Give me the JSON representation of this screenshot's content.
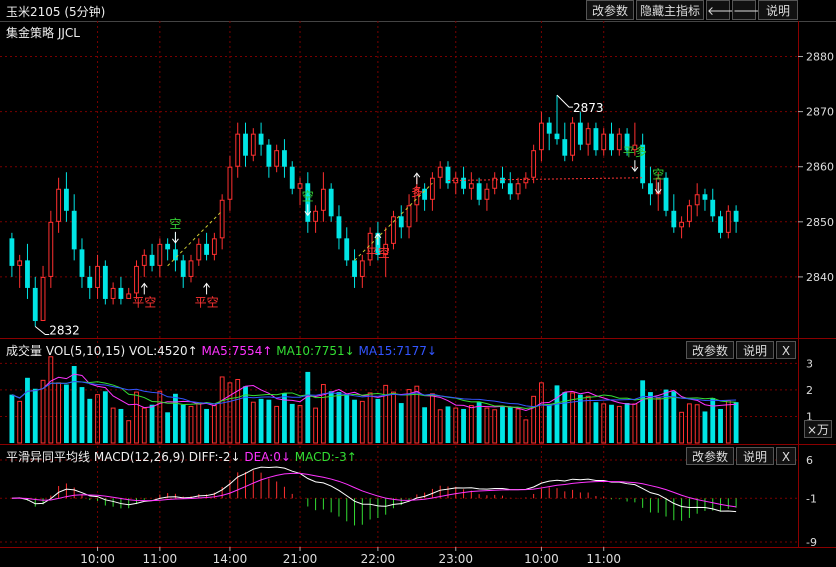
{
  "header": {
    "title": "玉米2105 (5分钟)",
    "modify_params": "改参数",
    "hide_indicator": "隐藏主指标",
    "prev_arrow": "🡐",
    "next_arrow": "🡒",
    "help": "说明"
  },
  "main_panel": {
    "indicator_label": "集金策略 JJCL",
    "price_axis": [
      "2880",
      "2870",
      "2860",
      "2850",
      "2840"
    ],
    "high_label": "2873",
    "low_label": "2832",
    "signals": [
      {
        "text": "空",
        "color": "#33cc33",
        "arrow": "down"
      },
      {
        "text": "平空",
        "color": "#ff3333",
        "arrow": "up"
      },
      {
        "text": "平空",
        "color": "#ff3333",
        "arrow": "up"
      },
      {
        "text": "空",
        "color": "#33cc33",
        "arrow": "down"
      },
      {
        "text": "平空",
        "color": "#ff3333",
        "arrow": "up"
      },
      {
        "text": "多",
        "color": "#ff3333",
        "arrow": "up"
      },
      {
        "text": "平多",
        "color": "#33cc33",
        "arrow": "down"
      },
      {
        "text": "空",
        "color": "#33cc33",
        "arrow": "down"
      }
    ]
  },
  "volume_panel": {
    "title": "成交量",
    "vol_text": "VOL(5,10,15)  VOL:4520↑",
    "ma5_text": "MA5:7554↑",
    "ma10_text": "MA10:7751↓",
    "ma15_text": "MA15:7177↓",
    "modify_params": "改参数",
    "help": "说明",
    "close": "X",
    "axis": [
      "3",
      "2",
      "1"
    ],
    "unit": "×万"
  },
  "macd_panel": {
    "title": "平滑异同平均线",
    "macd_text": "MACD(12,26,9)  DIFF:-2↓",
    "dea_text": "DEA:0↓",
    "macd_val_text": "MACD:-3↑",
    "modify_params": "改参数",
    "help": "说明",
    "close": "X",
    "axis": [
      "6",
      "-1",
      "-9"
    ]
  },
  "time_axis": [
    "10:00",
    "11:00",
    "14:00",
    "21:00",
    "22:00",
    "23:00",
    "10:00",
    "11:00"
  ],
  "colors": {
    "up": "#ff3030",
    "down": "#00e5e5",
    "ma5": "#ff33ff",
    "ma10": "#33dd33",
    "ma15": "#3355ff",
    "dif": "#ffffff",
    "dea": "#ff33ff",
    "grid": "#7a0000"
  },
  "chart_data": {
    "type": "candlestick",
    "yrange": [
      2830,
      2883
    ],
    "candles": [
      [
        2847,
        2848,
        2840,
        2842
      ],
      [
        2842,
        2844,
        2838,
        2843
      ],
      [
        2843,
        2846,
        2836,
        2838
      ],
      [
        2838,
        2840,
        2831,
        2832
      ],
      [
        2832,
        2842,
        2832,
        2840
      ],
      [
        2840,
        2852,
        2838,
        2850
      ],
      [
        2850,
        2858,
        2848,
        2856
      ],
      [
        2856,
        2859,
        2850,
        2852
      ],
      [
        2852,
        2855,
        2843,
        2845
      ],
      [
        2845,
        2847,
        2838,
        2840
      ],
      [
        2840,
        2842,
        2836,
        2838
      ],
      [
        2838,
        2844,
        2836,
        2842
      ],
      [
        2842,
        2843,
        2835,
        2836
      ],
      [
        2836,
        2839,
        2835,
        2838
      ],
      [
        2838,
        2840,
        2835,
        2836
      ],
      [
        2836,
        2838,
        2836,
        2837
      ],
      [
        2837,
        2843,
        2836,
        2842
      ],
      [
        2842,
        2845,
        2840,
        2844
      ],
      [
        2844,
        2846,
        2841,
        2842
      ],
      [
        2842,
        2847,
        2840,
        2846
      ],
      [
        2846,
        2847,
        2843,
        2845
      ],
      [
        2845,
        2848,
        2841,
        2843
      ],
      [
        2843,
        2844,
        2838,
        2840
      ],
      [
        2840,
        2844,
        2839,
        2843
      ],
      [
        2843,
        2847,
        2842,
        2846
      ],
      [
        2846,
        2848,
        2843,
        2844
      ],
      [
        2844,
        2848,
        2843,
        2847
      ],
      [
        2847,
        2855,
        2845,
        2854
      ],
      [
        2854,
        2862,
        2852,
        2860
      ],
      [
        2860,
        2868,
        2858,
        2866
      ],
      [
        2866,
        2868,
        2860,
        2862
      ],
      [
        2862,
        2867,
        2861,
        2866
      ],
      [
        2866,
        2868,
        2862,
        2864
      ],
      [
        2864,
        2865,
        2858,
        2860
      ],
      [
        2860,
        2864,
        2859,
        2863
      ],
      [
        2863,
        2865,
        2858,
        2860
      ],
      [
        2860,
        2861,
        2855,
        2856
      ],
      [
        2856,
        2858,
        2853,
        2857
      ],
      [
        2857,
        2859,
        2848,
        2850
      ],
      [
        2850,
        2853,
        2848,
        2852
      ],
      [
        2852,
        2859,
        2850,
        2856
      ],
      [
        2856,
        2857,
        2850,
        2851
      ],
      [
        2851,
        2853,
        2845,
        2847
      ],
      [
        2847,
        2849,
        2842,
        2843
      ],
      [
        2843,
        2845,
        2838,
        2840
      ],
      [
        2840,
        2844,
        2838,
        2843
      ],
      [
        2843,
        2849,
        2842,
        2848
      ],
      [
        2848,
        2850,
        2843,
        2844
      ],
      [
        2844,
        2849,
        2840,
        2846
      ],
      [
        2846,
        2852,
        2845,
        2851
      ],
      [
        2851,
        2853,
        2847,
        2849
      ],
      [
        2849,
        2855,
        2847,
        2853
      ],
      [
        2853,
        2858,
        2850,
        2856
      ],
      [
        2856,
        2857,
        2852,
        2854
      ],
      [
        2854,
        2859,
        2852,
        2858
      ],
      [
        2858,
        2861,
        2856,
        2860
      ],
      [
        2860,
        2861,
        2856,
        2857
      ],
      [
        2857,
        2859,
        2855,
        2858
      ],
      [
        2858,
        2860,
        2855,
        2856
      ],
      [
        2856,
        2859,
        2854,
        2857
      ],
      [
        2857,
        2858,
        2853,
        2854
      ],
      [
        2854,
        2857,
        2852,
        2856
      ],
      [
        2856,
        2859,
        2855,
        2858
      ],
      [
        2858,
        2860,
        2856,
        2857
      ],
      [
        2857,
        2859,
        2854,
        2855
      ],
      [
        2855,
        2858,
        2854,
        2857
      ],
      [
        2857,
        2859,
        2856,
        2858
      ],
      [
        2858,
        2864,
        2857,
        2863
      ],
      [
        2863,
        2870,
        2861,
        2868
      ],
      [
        2868,
        2869,
        2863,
        2866
      ],
      [
        2866,
        2873,
        2864,
        2865
      ],
      [
        2865,
        2868,
        2861,
        2862
      ],
      [
        2862,
        2869,
        2861,
        2868
      ],
      [
        2868,
        2870,
        2863,
        2864
      ],
      [
        2864,
        2868,
        2862,
        2867
      ],
      [
        2867,
        2868,
        2862,
        2863
      ],
      [
        2863,
        2867,
        2862,
        2866
      ],
      [
        2866,
        2868,
        2862,
        2863
      ],
      [
        2863,
        2867,
        2862,
        2866
      ],
      [
        2866,
        2867,
        2862,
        2863
      ],
      [
        2863,
        2868,
        2862,
        2864
      ],
      [
        2864,
        2866,
        2856,
        2857
      ],
      [
        2857,
        2860,
        2853,
        2855
      ],
      [
        2855,
        2859,
        2852,
        2858
      ],
      [
        2858,
        2859,
        2851,
        2852
      ],
      [
        2852,
        2855,
        2848,
        2849
      ],
      [
        2849,
        2851,
        2847,
        2850
      ],
      [
        2850,
        2854,
        2849,
        2853
      ],
      [
        2853,
        2857,
        2851,
        2855
      ],
      [
        2855,
        2856,
        2852,
        2854
      ],
      [
        2854,
        2856,
        2850,
        2851
      ],
      [
        2851,
        2852,
        2847,
        2848
      ],
      [
        2848,
        2853,
        2847,
        2852
      ],
      [
        2852,
        2853,
        2848,
        2850
      ]
    ]
  }
}
